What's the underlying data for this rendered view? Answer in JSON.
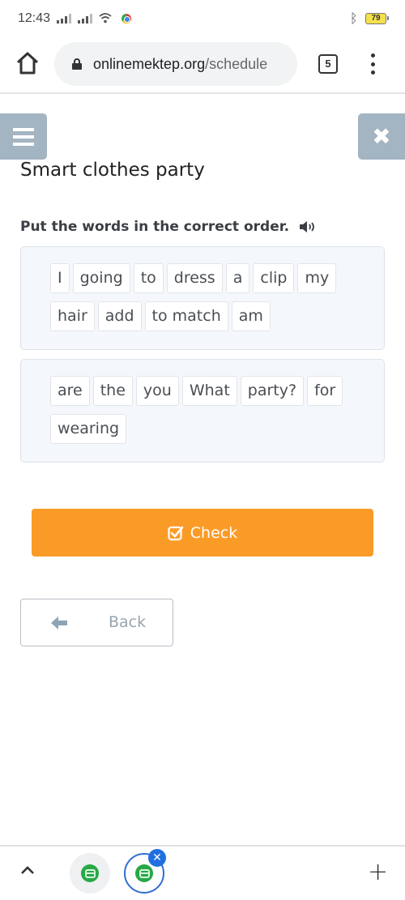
{
  "status_bar": {
    "time": "12:43",
    "battery_level": "79",
    "icons": [
      "signal-icon",
      "signal-icon",
      "wifi-icon",
      "chrome-icon",
      "bluetooth-icon",
      "battery-icon"
    ]
  },
  "browser": {
    "url_domain": "onlinemektep.org",
    "url_path": "/schedule",
    "tab_count": "5",
    "icons": {
      "home": "home-icon",
      "lock": "lock-icon",
      "menu": "more-vert-icon"
    }
  },
  "page": {
    "lesson_title": "Smart clothes party",
    "instruction": "Put the words in the correct order.",
    "exercises": [
      {
        "words": [
          "I",
          "going",
          "to",
          "dress",
          "a",
          "clip",
          "my",
          "hair",
          "add",
          "to match",
          "am"
        ]
      },
      {
        "words": [
          "are",
          "the",
          "you",
          "What",
          "party?",
          "for",
          "wearing"
        ]
      }
    ],
    "check_label": "Check",
    "back_label": "Back"
  },
  "colors": {
    "accent_orange": "#fb9b27",
    "side_button": "#a3b4c2",
    "word_box_bg": "#f4f7fb",
    "tab_active_ring": "#2f6fd0"
  },
  "tab_strip": {
    "tabs": [
      {
        "favicon": "green-b-favicon",
        "active": false
      },
      {
        "favicon": "green-b-favicon",
        "active": true
      }
    ],
    "new_tab_label": "+"
  }
}
